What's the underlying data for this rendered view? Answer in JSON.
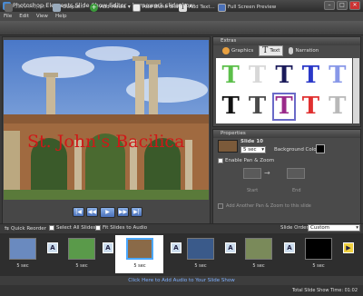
{
  "window": {
    "title": "Photoshop Elements Slide Show Editor - homework slideshow",
    "minimize": "–",
    "maximize": "□",
    "close": "✕"
  },
  "menu": [
    "File",
    "Edit",
    "View",
    "Help"
  ],
  "toolbar": {
    "save_project": "Save Project",
    "output": "Output...",
    "add_media": "Add Media",
    "add_blank_slide": "Add Blank Slide",
    "add_text": "Add Text...",
    "full_screen_preview": "Full Screen Preview"
  },
  "preview": {
    "caption": "St. John's Bacilica"
  },
  "transport": {
    "first": "|◀",
    "prev": "◀◀",
    "play": "▶",
    "next": "▶▶",
    "last": "▶|"
  },
  "extras": {
    "header": "Extras",
    "tabs": [
      "Graphics",
      "Text",
      "Narration"
    ],
    "active_tab": "Text",
    "text_styles": [
      {
        "glyph": "T",
        "color": "#5cbf4a"
      },
      {
        "glyph": "T",
        "color": "#d8d8d8"
      },
      {
        "glyph": "T",
        "color": "#1a1a5a"
      },
      {
        "glyph": "T",
        "color": "#2a38c8"
      },
      {
        "glyph": "T",
        "color": "#8898e8"
      },
      {
        "glyph": "T",
        "color": "#111111"
      },
      {
        "glyph": "T",
        "color": "#4a4a4a"
      },
      {
        "glyph": "T",
        "color": "#9a2a8a"
      },
      {
        "glyph": "T",
        "color": "#e03030"
      },
      {
        "glyph": "T",
        "color": "#b8b8b8"
      }
    ],
    "selected_index": 7
  },
  "properties": {
    "header": "Properties",
    "slide_label": "Slide 10",
    "duration": "5 sec",
    "bg_color_label": "Background Color",
    "bg_color": "#000000",
    "enable_pan_zoom": "Enable Pan & Zoom",
    "start_label": "Start",
    "end_label": "End",
    "add_pan_zoom": "Add Another Pan & Zoom to this slide"
  },
  "filmstrip_bar": {
    "quick_reorder": "Quick Reorder",
    "select_all": "Select All Slides",
    "fit_audio": "Fit Slides to Audio",
    "slide_order_label": "Slide Order:",
    "slide_order_value": "Custom"
  },
  "slides": [
    {
      "duration": "5 sec",
      "color": "#6a8abf"
    },
    {
      "duration": "5 sec",
      "color": "#5a9a4a"
    },
    {
      "duration": "5 sec",
      "color": "#8a6a48"
    },
    {
      "duration": "5 sec",
      "color": "#3a5a8a"
    },
    {
      "duration": "5 sec",
      "color": "#7a8a5a"
    },
    {
      "duration": "5 sec",
      "color": "#000000"
    }
  ],
  "audio_hint": "Click Here to Add Audio to Your Slide Show",
  "status": "Total Slide Show Time: 01:02"
}
